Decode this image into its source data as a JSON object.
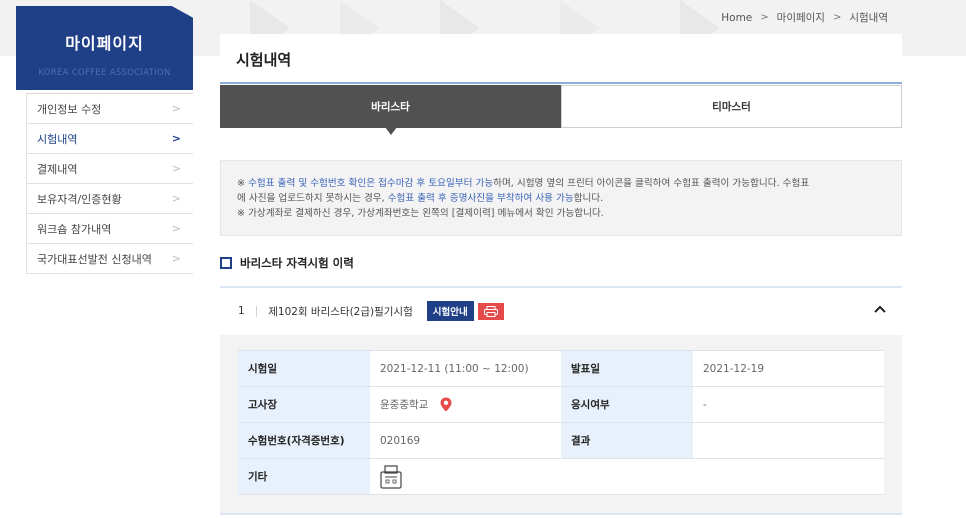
{
  "breadcrumb": [
    "Home",
    "마이페이지",
    "시험내역"
  ],
  "sidebar": {
    "title": "마이페이지",
    "subtitle": "KOREA COFFEE ASSOCIATION",
    "items": [
      {
        "label": "개인정보 수정"
      },
      {
        "label": "시험내역"
      },
      {
        "label": "결제내역"
      },
      {
        "label": "보유자격/인증현황"
      },
      {
        "label": "워크숍 참가내역"
      },
      {
        "label": "국가대표선발전 신청내역"
      }
    ],
    "active_index": 1
  },
  "main": {
    "title": "시험내역",
    "tabs": [
      {
        "label": "바리스타"
      },
      {
        "label": "티마스터"
      }
    ],
    "active_tab": 0,
    "notice": {
      "l1_a": "※ ",
      "l1_b": "수험표 출력 및 수험번호 확인은 접수마감 후 토요일부터 가능",
      "l1_c": "하며, 시험명 옆의 프린터 아이콘을 클릭하여 수험표 출력이 가능합니다. 수험표",
      "l2_a": "에 사진을 업로드하지 못하시는 경우, ",
      "l2_b": "수험표 출력 후 증명사진을 부착하여 사용 가능",
      "l2_c": "합니다.",
      "l3": "※ 가상계좌로 결제하신 경우, 가상계좌번호는 왼쪽의 [결제이력] 메뉴에서 확인 가능합니다."
    },
    "section_title": "바리스타 자격시험 이력",
    "exam": {
      "number": "1",
      "name": "제102회 바리스타(2급)필기시험",
      "guide_label": "시험안내",
      "details": {
        "exam_date_label": "시험일",
        "exam_date": "2021-12-11 (11:00 ~ 12:00)",
        "announce_label": "발표일",
        "announce_date": "2021-12-19",
        "venue_label": "고사장",
        "venue": "윤중중학교",
        "attend_label": "응시여부",
        "attend": "-",
        "exam_no_label": "수험번호(자격증번호)",
        "exam_no": "020169",
        "result_label": "결과",
        "result": "",
        "etc_label": "기타"
      }
    }
  },
  "colors": {
    "brand": "#1f3f87",
    "highlight": "#3a63b8",
    "print_badge": "#e64b4b",
    "active_tab": "#515151",
    "location_pin": "#e64b4b"
  },
  "icons": [
    "chevron-right-icon",
    "caret-up-icon",
    "printer-icon",
    "location-pin-icon",
    "ticket-icon"
  ]
}
